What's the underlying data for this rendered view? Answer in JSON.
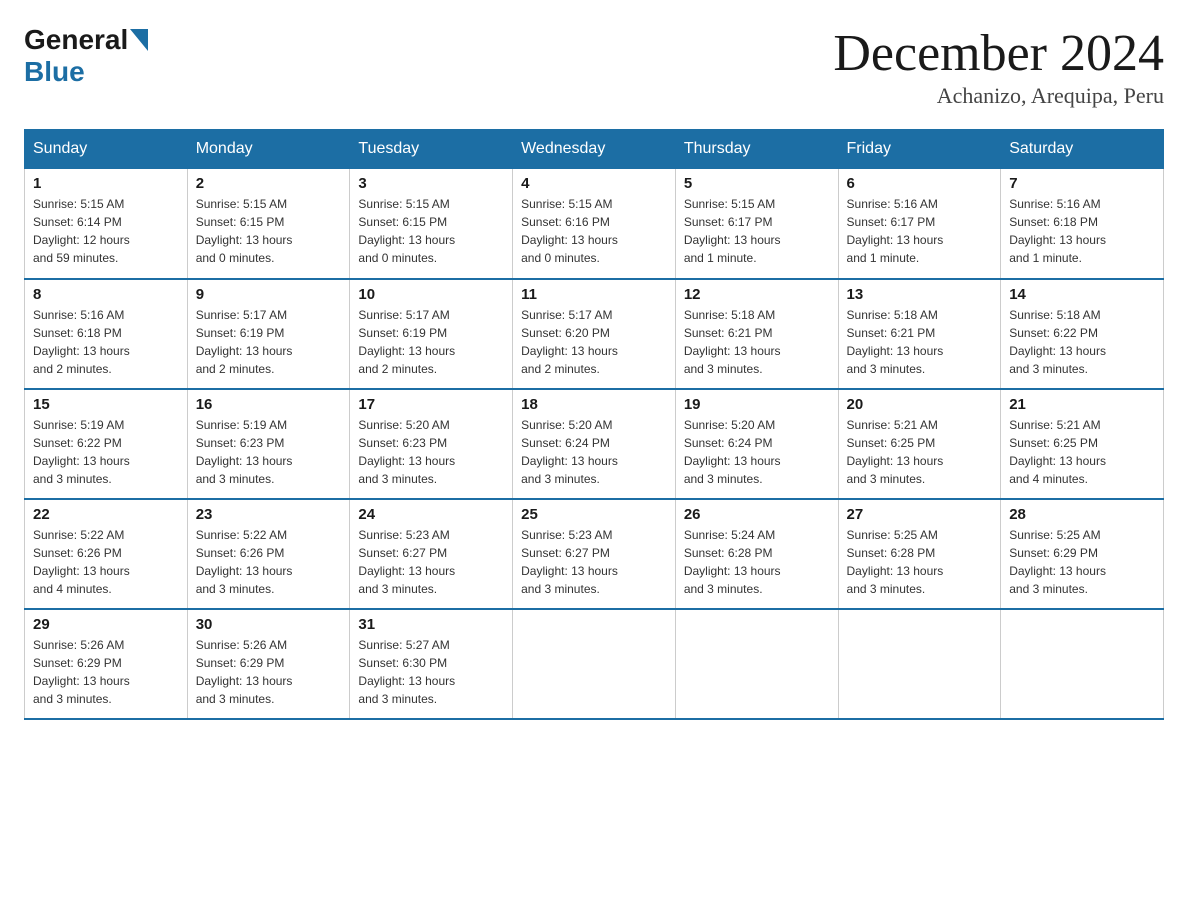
{
  "logo": {
    "general": "General",
    "blue": "Blue"
  },
  "title": {
    "month": "December 2024",
    "location": "Achanizo, Arequipa, Peru"
  },
  "headers": [
    "Sunday",
    "Monday",
    "Tuesday",
    "Wednesday",
    "Thursday",
    "Friday",
    "Saturday"
  ],
  "weeks": [
    [
      {
        "day": "1",
        "sunrise": "5:15 AM",
        "sunset": "6:14 PM",
        "daylight": "12 hours and 59 minutes."
      },
      {
        "day": "2",
        "sunrise": "5:15 AM",
        "sunset": "6:15 PM",
        "daylight": "13 hours and 0 minutes."
      },
      {
        "day": "3",
        "sunrise": "5:15 AM",
        "sunset": "6:15 PM",
        "daylight": "13 hours and 0 minutes."
      },
      {
        "day": "4",
        "sunrise": "5:15 AM",
        "sunset": "6:16 PM",
        "daylight": "13 hours and 0 minutes."
      },
      {
        "day": "5",
        "sunrise": "5:15 AM",
        "sunset": "6:17 PM",
        "daylight": "13 hours and 1 minute."
      },
      {
        "day": "6",
        "sunrise": "5:16 AM",
        "sunset": "6:17 PM",
        "daylight": "13 hours and 1 minute."
      },
      {
        "day": "7",
        "sunrise": "5:16 AM",
        "sunset": "6:18 PM",
        "daylight": "13 hours and 1 minute."
      }
    ],
    [
      {
        "day": "8",
        "sunrise": "5:16 AM",
        "sunset": "6:18 PM",
        "daylight": "13 hours and 2 minutes."
      },
      {
        "day": "9",
        "sunrise": "5:17 AM",
        "sunset": "6:19 PM",
        "daylight": "13 hours and 2 minutes."
      },
      {
        "day": "10",
        "sunrise": "5:17 AM",
        "sunset": "6:19 PM",
        "daylight": "13 hours and 2 minutes."
      },
      {
        "day": "11",
        "sunrise": "5:17 AM",
        "sunset": "6:20 PM",
        "daylight": "13 hours and 2 minutes."
      },
      {
        "day": "12",
        "sunrise": "5:18 AM",
        "sunset": "6:21 PM",
        "daylight": "13 hours and 3 minutes."
      },
      {
        "day": "13",
        "sunrise": "5:18 AM",
        "sunset": "6:21 PM",
        "daylight": "13 hours and 3 minutes."
      },
      {
        "day": "14",
        "sunrise": "5:18 AM",
        "sunset": "6:22 PM",
        "daylight": "13 hours and 3 minutes."
      }
    ],
    [
      {
        "day": "15",
        "sunrise": "5:19 AM",
        "sunset": "6:22 PM",
        "daylight": "13 hours and 3 minutes."
      },
      {
        "day": "16",
        "sunrise": "5:19 AM",
        "sunset": "6:23 PM",
        "daylight": "13 hours and 3 minutes."
      },
      {
        "day": "17",
        "sunrise": "5:20 AM",
        "sunset": "6:23 PM",
        "daylight": "13 hours and 3 minutes."
      },
      {
        "day": "18",
        "sunrise": "5:20 AM",
        "sunset": "6:24 PM",
        "daylight": "13 hours and 3 minutes."
      },
      {
        "day": "19",
        "sunrise": "5:20 AM",
        "sunset": "6:24 PM",
        "daylight": "13 hours and 3 minutes."
      },
      {
        "day": "20",
        "sunrise": "5:21 AM",
        "sunset": "6:25 PM",
        "daylight": "13 hours and 3 minutes."
      },
      {
        "day": "21",
        "sunrise": "5:21 AM",
        "sunset": "6:25 PM",
        "daylight": "13 hours and 4 minutes."
      }
    ],
    [
      {
        "day": "22",
        "sunrise": "5:22 AM",
        "sunset": "6:26 PM",
        "daylight": "13 hours and 4 minutes."
      },
      {
        "day": "23",
        "sunrise": "5:22 AM",
        "sunset": "6:26 PM",
        "daylight": "13 hours and 3 minutes."
      },
      {
        "day": "24",
        "sunrise": "5:23 AM",
        "sunset": "6:27 PM",
        "daylight": "13 hours and 3 minutes."
      },
      {
        "day": "25",
        "sunrise": "5:23 AM",
        "sunset": "6:27 PM",
        "daylight": "13 hours and 3 minutes."
      },
      {
        "day": "26",
        "sunrise": "5:24 AM",
        "sunset": "6:28 PM",
        "daylight": "13 hours and 3 minutes."
      },
      {
        "day": "27",
        "sunrise": "5:25 AM",
        "sunset": "6:28 PM",
        "daylight": "13 hours and 3 minutes."
      },
      {
        "day": "28",
        "sunrise": "5:25 AM",
        "sunset": "6:29 PM",
        "daylight": "13 hours and 3 minutes."
      }
    ],
    [
      {
        "day": "29",
        "sunrise": "5:26 AM",
        "sunset": "6:29 PM",
        "daylight": "13 hours and 3 minutes."
      },
      {
        "day": "30",
        "sunrise": "5:26 AM",
        "sunset": "6:29 PM",
        "daylight": "13 hours and 3 minutes."
      },
      {
        "day": "31",
        "sunrise": "5:27 AM",
        "sunset": "6:30 PM",
        "daylight": "13 hours and 3 minutes."
      },
      null,
      null,
      null,
      null
    ]
  ],
  "labels": {
    "sunrise": "Sunrise:",
    "sunset": "Sunset:",
    "daylight": "Daylight:"
  }
}
